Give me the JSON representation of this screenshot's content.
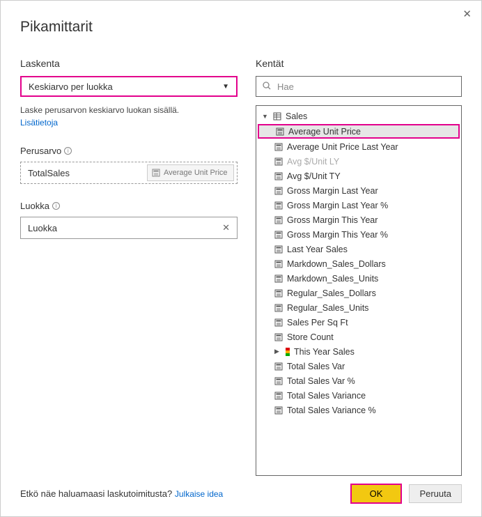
{
  "header": {
    "title": "Pikamittarit"
  },
  "left": {
    "calc_heading": "Laskenta",
    "dropdown_value": "Keskiarvo per luokka",
    "description": "Laske perusarvon keskiarvo luokan sisällä.",
    "more_info": "Lisätietoja",
    "base_heading": "Perusarvo",
    "base_value": "TotalSales",
    "drag_chip": "Average Unit Price",
    "cat_heading": "Luokka",
    "cat_value": "Luokka"
  },
  "right": {
    "fields_heading": "Kentät",
    "search_placeholder": "Hae",
    "table_name": "Sales",
    "fields": [
      {
        "label": "Average Unit Price",
        "highlighted": true,
        "selected": true
      },
      {
        "label": "Average Unit Price Last Year"
      },
      {
        "label": "Avg $/Unit LY",
        "dim": true
      },
      {
        "label": "Avg $/Unit TY"
      },
      {
        "label": "Gross Margin Last Year"
      },
      {
        "label": "Gross Margin Last Year %"
      },
      {
        "label": "Gross Margin This Year"
      },
      {
        "label": "Gross Margin This Year %"
      },
      {
        "label": "Last Year Sales"
      },
      {
        "label": "Markdown_Sales_Dollars"
      },
      {
        "label": "Markdown_Sales_Units"
      },
      {
        "label": "Regular_Sales_Dollars"
      },
      {
        "label": "Regular_Sales_Units"
      },
      {
        "label": "Sales Per Sq Ft"
      },
      {
        "label": "Store Count"
      },
      {
        "label": "This Year Sales",
        "expandable": true,
        "traffic": true
      },
      {
        "label": "Total Sales Var"
      },
      {
        "label": "Total Sales Var %"
      },
      {
        "label": "Total Sales Variance"
      },
      {
        "label": "Total Sales Variance %"
      }
    ]
  },
  "footer": {
    "prompt": "Etkö näe haluamaasi laskutoimitusta? ",
    "link": "Julkaise idea",
    "ok": "OK",
    "cancel": "Peruuta"
  }
}
